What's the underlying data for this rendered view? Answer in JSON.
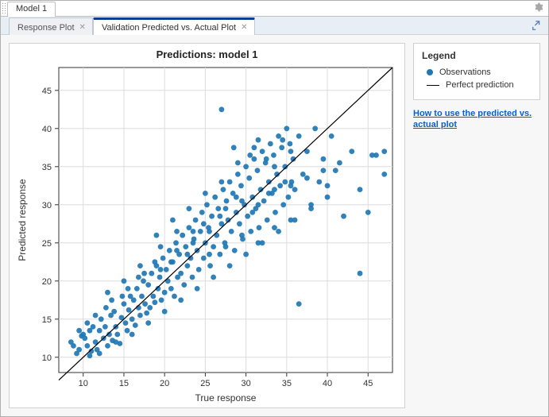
{
  "outer_tab": {
    "label": "Model 1"
  },
  "inner_tabs": {
    "inactive": {
      "label": "Response Plot"
    },
    "active": {
      "label": "Validation Predicted vs. Actual Plot"
    }
  },
  "legend": {
    "title": "Legend",
    "items": {
      "observations": "Observations",
      "perfect": "Perfect prediction"
    }
  },
  "help_link": "How to use the predicted vs. actual plot",
  "chart_data": {
    "type": "scatter",
    "title": "Predictions: model 1",
    "xlabel": "True response",
    "ylabel": "Predicted response",
    "xlim": [
      7,
      48
    ],
    "ylim": [
      8,
      48
    ],
    "xticks": [
      10,
      15,
      20,
      25,
      30,
      35,
      40,
      45
    ],
    "yticks": [
      10,
      15,
      20,
      25,
      30,
      35,
      40,
      45
    ],
    "series": [
      {
        "name": "Observations",
        "color": "#1f77b4",
        "marker": "circle",
        "points": [
          [
            8.5,
            12
          ],
          [
            9.2,
            10.5
          ],
          [
            9.5,
            11
          ],
          [
            10,
            13
          ],
          [
            10.2,
            12.5
          ],
          [
            10.5,
            11.5
          ],
          [
            10.8,
            13.5
          ],
          [
            11,
            10.8
          ],
          [
            11.2,
            14
          ],
          [
            11.5,
            12
          ],
          [
            11.7,
            11
          ],
          [
            12,
            13.5
          ],
          [
            12.2,
            15
          ],
          [
            12.5,
            12.5
          ],
          [
            12.7,
            14
          ],
          [
            13,
            11.5
          ],
          [
            13.2,
            13
          ],
          [
            13.4,
            15.5
          ],
          [
            13.6,
            12.2
          ],
          [
            13.8,
            16
          ],
          [
            14,
            14
          ],
          [
            14.2,
            13
          ],
          [
            14.5,
            11.8
          ],
          [
            14.7,
            15.2
          ],
          [
            15,
            17
          ],
          [
            15.2,
            14.5
          ],
          [
            15.4,
            13.5
          ],
          [
            15.6,
            16.2
          ],
          [
            15.8,
            18
          ],
          [
            16,
            15
          ],
          [
            16.2,
            17.5
          ],
          [
            16.4,
            14.2
          ],
          [
            16.6,
            19
          ],
          [
            16.8,
            16.5
          ],
          [
            17,
            15.5
          ],
          [
            17.2,
            18
          ],
          [
            17.4,
            20
          ],
          [
            17.6,
            17
          ],
          [
            17.8,
            15.8
          ],
          [
            18,
            19.5
          ],
          [
            18.2,
            16.5
          ],
          [
            18.4,
            21
          ],
          [
            18.6,
            18
          ],
          [
            18.8,
            17.2
          ],
          [
            19,
            22
          ],
          [
            19.2,
            19
          ],
          [
            19.4,
            20.5
          ],
          [
            19.6,
            17.5
          ],
          [
            19.8,
            23
          ],
          [
            20,
            18.5
          ],
          [
            20.2,
            21.5
          ],
          [
            20.4,
            20
          ],
          [
            20.6,
            24
          ],
          [
            20.8,
            19
          ],
          [
            21,
            22.5
          ],
          [
            21.2,
            18
          ],
          [
            21.4,
            25
          ],
          [
            21.6,
            20.5
          ],
          [
            21.8,
            23.5
          ],
          [
            22,
            21
          ],
          [
            22.2,
            26
          ],
          [
            22.4,
            19.5
          ],
          [
            22.6,
            24.5
          ],
          [
            22.8,
            22
          ],
          [
            23,
            27
          ],
          [
            23.2,
            23
          ],
          [
            23.4,
            20.5
          ],
          [
            23.6,
            25.5
          ],
          [
            23.8,
            28
          ],
          [
            24,
            24
          ],
          [
            24.2,
            21.5
          ],
          [
            24.4,
            26.5
          ],
          [
            24.6,
            29
          ],
          [
            24.8,
            23
          ],
          [
            25,
            25
          ],
          [
            25.2,
            30
          ],
          [
            25.4,
            27
          ],
          [
            25.6,
            22
          ],
          [
            25.8,
            28.5
          ],
          [
            26,
            24.5
          ],
          [
            26.2,
            31
          ],
          [
            26.4,
            26
          ],
          [
            26.6,
            29.5
          ],
          [
            26.8,
            23.5
          ],
          [
            27,
            27.5
          ],
          [
            27.2,
            32
          ],
          [
            27.4,
            25
          ],
          [
            27.6,
            30.5
          ],
          [
            27.8,
            28
          ],
          [
            28,
            33
          ],
          [
            28.2,
            26.5
          ],
          [
            28.4,
            31.5
          ],
          [
            28.6,
            24
          ],
          [
            28.8,
            29
          ],
          [
            29,
            34
          ],
          [
            29.2,
            27.5
          ],
          [
            29.4,
            32.5
          ],
          [
            29.6,
            25.5
          ],
          [
            29.8,
            30
          ],
          [
            30,
            35
          ],
          [
            30.2,
            28.5
          ],
          [
            30.4,
            33.5
          ],
          [
            30.6,
            26.5
          ],
          [
            30.8,
            31
          ],
          [
            31,
            36
          ],
          [
            31.2,
            29.5
          ],
          [
            31.4,
            34.5
          ],
          [
            31.6,
            27
          ],
          [
            31.8,
            32
          ],
          [
            32,
            37
          ],
          [
            32.2,
            30.5
          ],
          [
            32.4,
            35.5
          ],
          [
            32.6,
            28
          ],
          [
            32.8,
            33
          ],
          [
            33,
            38
          ],
          [
            33.2,
            31.5
          ],
          [
            33.4,
            36.5
          ],
          [
            33.6,
            29
          ],
          [
            33.8,
            34
          ],
          [
            34,
            39
          ],
          [
            34.2,
            32.5
          ],
          [
            34.4,
            37.5
          ],
          [
            34.6,
            30
          ],
          [
            34.8,
            35
          ],
          [
            35,
            40
          ],
          [
            35.2,
            31
          ],
          [
            35.4,
            38
          ],
          [
            35.6,
            33
          ],
          [
            35.8,
            36
          ],
          [
            36,
            32
          ],
          [
            36.5,
            39
          ],
          [
            37,
            34
          ],
          [
            37.5,
            37
          ],
          [
            38,
            30
          ],
          [
            38.5,
            40
          ],
          [
            39,
            33
          ],
          [
            39.5,
            36
          ],
          [
            40,
            31
          ],
          [
            40.5,
            39
          ],
          [
            41,
            34.5
          ],
          [
            42,
            28.5
          ],
          [
            43,
            37
          ],
          [
            44,
            32
          ],
          [
            45,
            29
          ],
          [
            46,
            36.5
          ],
          [
            47,
            34
          ],
          [
            36.5,
            17
          ],
          [
            44,
            21
          ],
          [
            27,
            42.5
          ],
          [
            19.5,
            24.5
          ],
          [
            21.5,
            26.5
          ],
          [
            23.5,
            25
          ],
          [
            25.5,
            23.5
          ],
          [
            27.5,
            24.5
          ],
          [
            29.5,
            26
          ],
          [
            31.5,
            25
          ],
          [
            33.5,
            27
          ],
          [
            35.5,
            28
          ],
          [
            10.5,
            14.5
          ],
          [
            12.8,
            16.5
          ],
          [
            14.8,
            18
          ],
          [
            16.8,
            20.5
          ],
          [
            18.8,
            22.5
          ],
          [
            20.8,
            22.5
          ],
          [
            22.8,
            23.5
          ],
          [
            24.8,
            27.5
          ],
          [
            26.8,
            28.5
          ],
          [
            28.8,
            31
          ],
          [
            30.8,
            29
          ],
          [
            32.8,
            31.5
          ],
          [
            34.8,
            33
          ],
          [
            9.5,
            13.5
          ],
          [
            11.5,
            15.5
          ],
          [
            13.5,
            17.5
          ],
          [
            15.5,
            19
          ],
          [
            17.5,
            21
          ],
          [
            19.5,
            21.5
          ],
          [
            21.5,
            24
          ],
          [
            23.5,
            26.5
          ],
          [
            25.5,
            26.5
          ],
          [
            27.5,
            29.5
          ],
          [
            29.5,
            30.5
          ],
          [
            31.5,
            30
          ],
          [
            33.5,
            32
          ],
          [
            35.5,
            32.5
          ],
          [
            37.5,
            33.5
          ],
          [
            39.5,
            34.5
          ],
          [
            41.5,
            35.5
          ],
          [
            13,
            18.5
          ],
          [
            15,
            20
          ],
          [
            17,
            22
          ],
          [
            19,
            26
          ],
          [
            21,
            28
          ],
          [
            23,
            29.5
          ],
          [
            25,
            31.5
          ],
          [
            27,
            33
          ],
          [
            29,
            35.5
          ],
          [
            31,
            37.5
          ],
          [
            12,
            10.5
          ],
          [
            14,
            12
          ],
          [
            16,
            13
          ],
          [
            18,
            14.5
          ],
          [
            20,
            16
          ],
          [
            22,
            17.5
          ],
          [
            24,
            19
          ],
          [
            26,
            20.5
          ],
          [
            28,
            22
          ],
          [
            30,
            23.5
          ],
          [
            32,
            25
          ],
          [
            34,
            26.5
          ],
          [
            36,
            28
          ],
          [
            38,
            29.5
          ],
          [
            40,
            32.5
          ],
          [
            45.5,
            36.5
          ],
          [
            47,
            37
          ],
          [
            8.8,
            11.5
          ],
          [
            9.8,
            12.8
          ],
          [
            10.8,
            10.2
          ],
          [
            30.5,
            36.5
          ],
          [
            31.5,
            38.5
          ],
          [
            32.5,
            36
          ],
          [
            33.5,
            35
          ],
          [
            34.5,
            38.5
          ],
          [
            35.5,
            37
          ],
          [
            28.5,
            37.5
          ]
        ]
      },
      {
        "name": "Perfect prediction",
        "type": "line",
        "color": "#000000",
        "points": [
          [
            7,
            7
          ],
          [
            48,
            48
          ]
        ]
      }
    ]
  }
}
